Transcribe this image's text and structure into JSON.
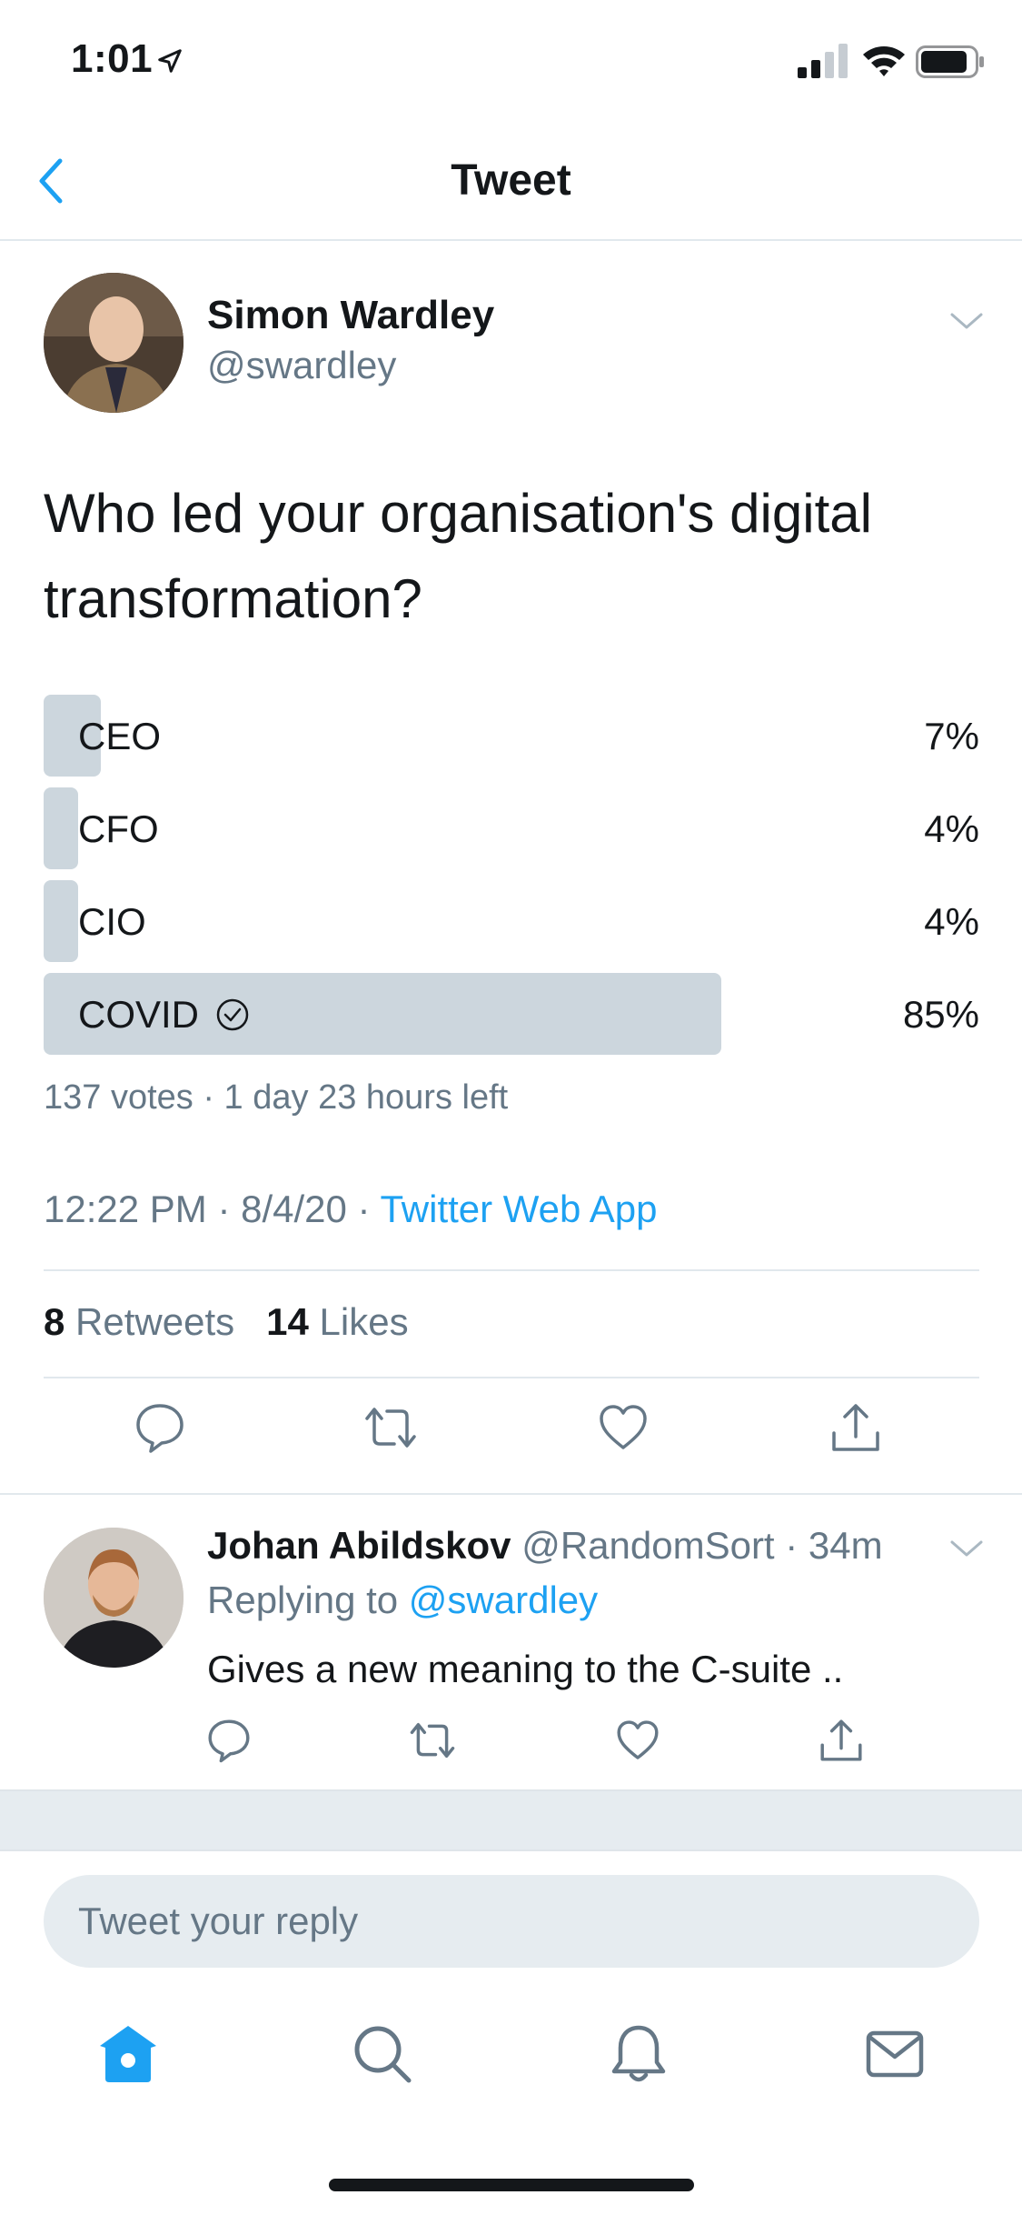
{
  "status_bar": {
    "time": "1:01"
  },
  "nav": {
    "title": "Tweet"
  },
  "tweet": {
    "author_name": "Simon Wardley",
    "author_handle": "@swardley",
    "text": "Who led your organisation's digital transformation?",
    "poll": {
      "options": [
        {
          "label": "CEO",
          "percent": "7%",
          "value": 7
        },
        {
          "label": "CFO",
          "percent": "4%",
          "value": 4
        },
        {
          "label": "CIO",
          "percent": "4%",
          "value": 4
        },
        {
          "label": "COVID",
          "percent": "85%",
          "value": 85,
          "winner": true
        }
      ],
      "meta": "137 votes · 1 day 23 hours left"
    },
    "timestamp": "12:22 PM · 8/4/20 · ",
    "source": "Twitter Web App",
    "retweets_count": "8",
    "retweets_label": "Retweets",
    "likes_count": "14",
    "likes_label": "Likes"
  },
  "reply": {
    "author_name": "Johan Abildskov",
    "author_handle": "@RandomSort · 34m",
    "replying_prefix": "Replying to ",
    "replying_mention": "@swardley",
    "text": "Gives a new meaning to the C-suite .."
  },
  "composer": {
    "placeholder": "Tweet your reply"
  },
  "colors": {
    "accent": "#1da1f2",
    "text": "#14171a",
    "secondary": "#657786",
    "poll_bar": "#ccd6dd",
    "divider": "#e1e8ed"
  },
  "icons": {
    "status": [
      "location-arrow-icon",
      "signal-icon",
      "wifi-icon",
      "battery-icon"
    ],
    "nav": [
      "back-chevron-icon"
    ],
    "actions": [
      "reply-icon",
      "retweet-icon",
      "like-icon",
      "share-icon"
    ],
    "tabs": [
      "home-icon",
      "search-icon",
      "notifications-icon",
      "messages-icon"
    ]
  }
}
